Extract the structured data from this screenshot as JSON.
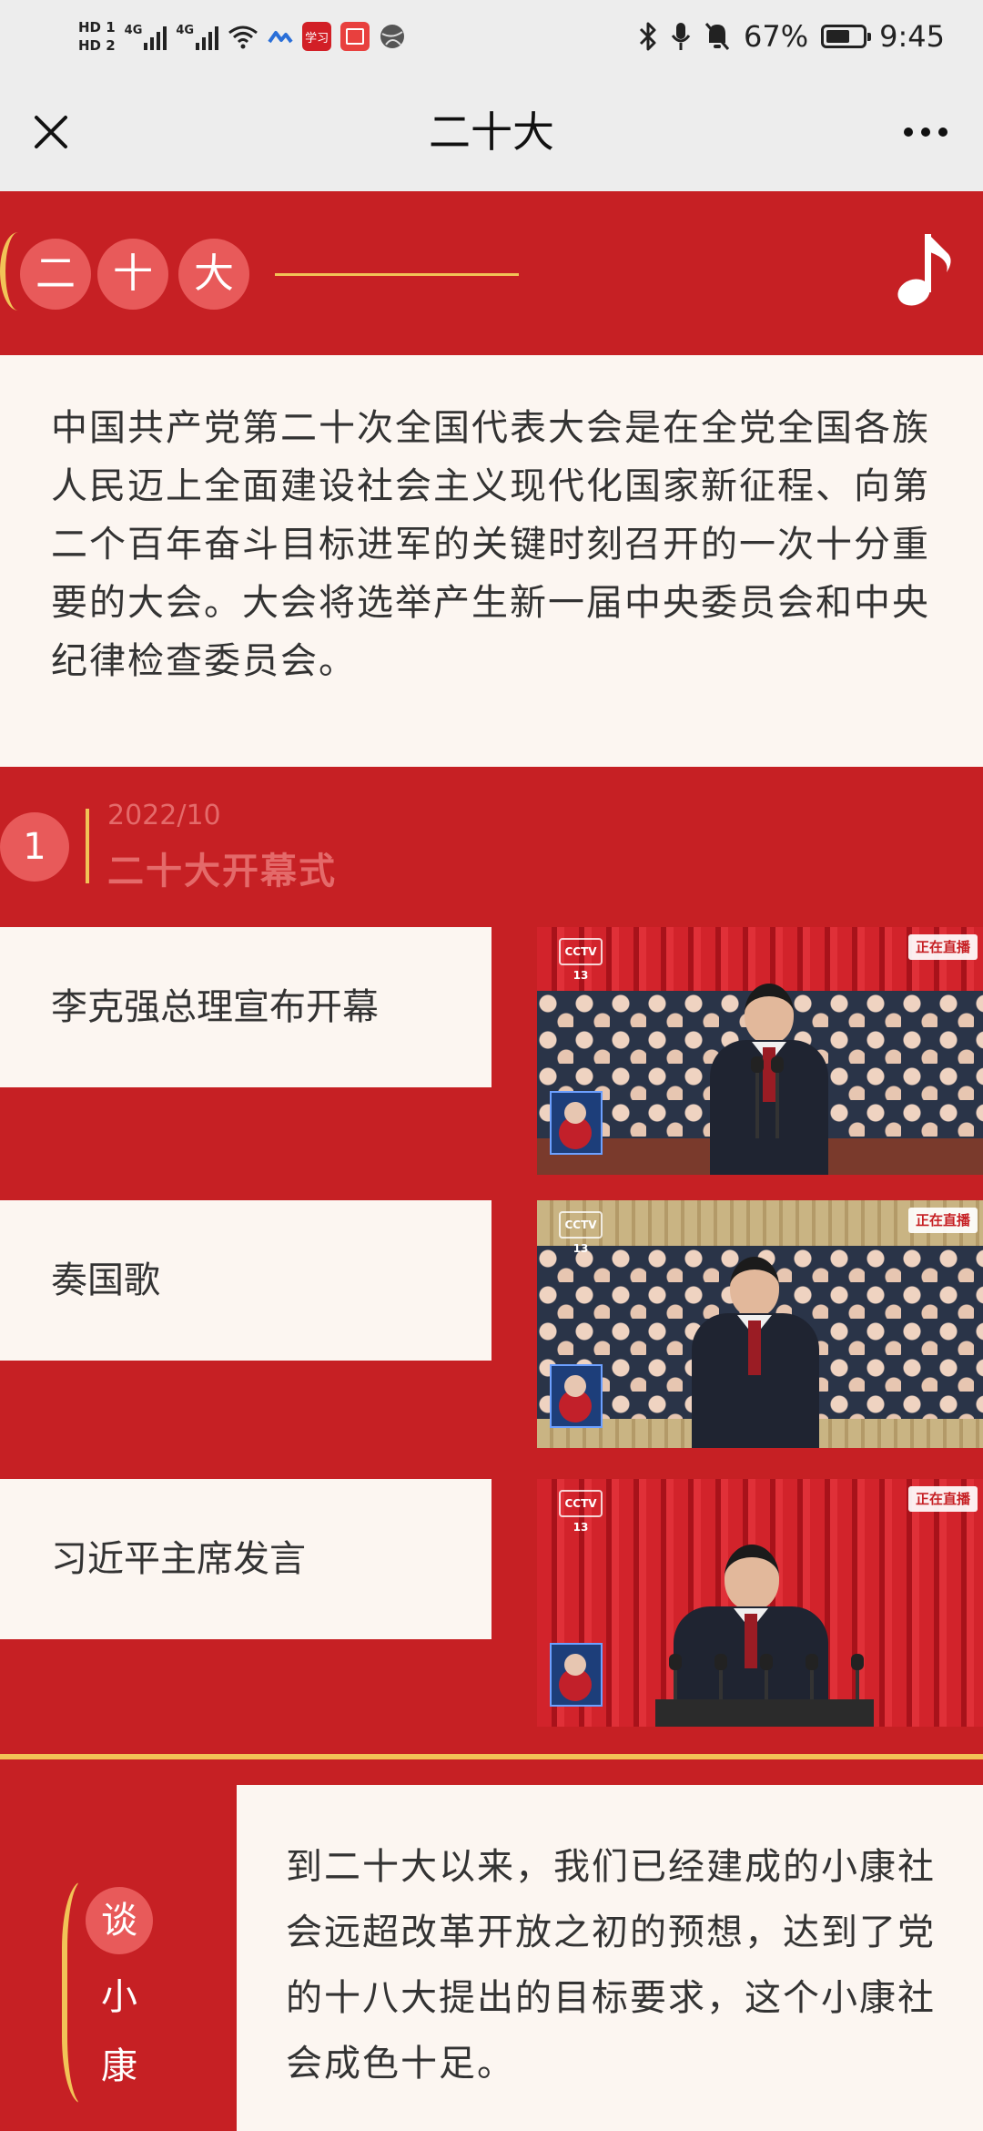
{
  "status_bar": {
    "hd1": "HD 1",
    "hd2": "HD 2",
    "net1": "4G",
    "net2": "4G",
    "app_label": "学习",
    "battery_percent": "67%",
    "battery_level": 0.67,
    "time": "9:45"
  },
  "title_bar": {
    "title": "二十大",
    "close_icon": "close-icon",
    "more_icon": "more-dots-icon"
  },
  "banner": {
    "chars": [
      "二",
      "十",
      "大"
    ],
    "music_icon": "music-note-icon"
  },
  "intro": {
    "text": "中国共产党第二十次全国代表大会是在全党全国各族人民迈上全面建设社会主义现代化国家新征程、向第二个百年奋斗目标进军的关键时刻召开的一次十分重要的大会。大会将选举产生新一届中央委员会和中央纪律检查委员会。"
  },
  "section": {
    "number": "1",
    "date": "2022/10",
    "title": "二十大开幕式"
  },
  "items": [
    {
      "label": "李克强总理宣布开幕",
      "thumb_badge": "CCTV 13",
      "thumb_live": "正在直播"
    },
    {
      "label": "奏国歌",
      "thumb_badge": "CCTV 13",
      "thumb_live": "正在直播"
    },
    {
      "label": "习近平主席发言",
      "thumb_badge": "CCTV 13",
      "thumb_live": "正在直播"
    }
  ],
  "bottom": {
    "side_chars": [
      "谈",
      "小",
      "康"
    ],
    "text": "到二十大以来，我们已经建成的小康社会远超改革开放之初的预想，达到了党的十八大提出的目标要求，这个小康社会成色十足。"
  },
  "colors": {
    "brand_red": "#c62024",
    "accent_gold": "#f2c357",
    "circle_red": "#e85a5a",
    "card_bg": "#fcf6f1"
  }
}
